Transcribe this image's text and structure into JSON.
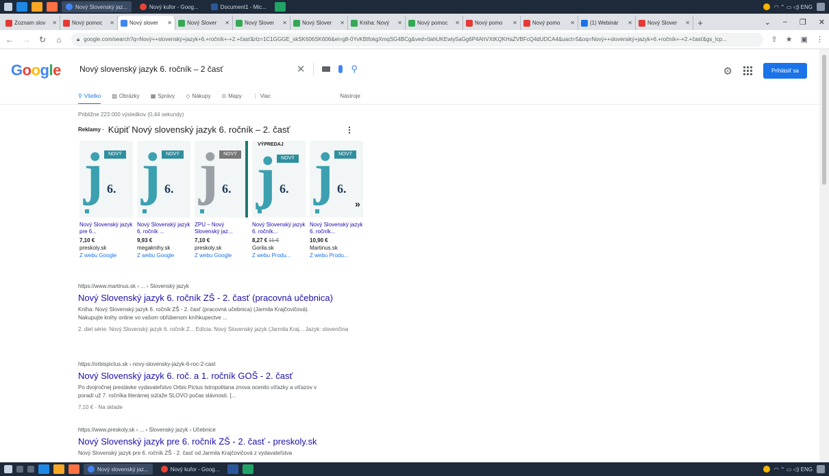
{
  "taskbar_top": {
    "apps": [
      {
        "label": "Nový Slovenský jaz...",
        "active": true
      },
      {
        "label": "Nový kufor - Goog...",
        "active": false
      },
      {
        "label": "Document1 - Mic...",
        "active": false
      }
    ]
  },
  "taskbar_bottom": {
    "apps": [
      {
        "label": "Nový slovenský jaz...",
        "active": true
      },
      {
        "label": "Nový kufor - Goog...",
        "active": false
      }
    ]
  },
  "browser_tabs": [
    {
      "title": "Zoznam slov",
      "color": "#e53935"
    },
    {
      "title": "Nový pomoc",
      "color": "#e53935"
    },
    {
      "title": "Nový slover",
      "color": "#4285f4"
    },
    {
      "title": "Nový Slover",
      "color": "#34a853"
    },
    {
      "title": "Nový Slover",
      "color": "#34a853"
    },
    {
      "title": "Nový Slover",
      "color": "#34a853"
    },
    {
      "title": "Kniha: Nový",
      "color": "#34a853"
    },
    {
      "title": "Nový pomoc",
      "color": "#34a853"
    },
    {
      "title": "Nový pomo",
      "color": "#e53935"
    },
    {
      "title": "Nový pomo",
      "color": "#e53935"
    },
    {
      "title": "(1) Webinár",
      "color": "#1a73e8"
    },
    {
      "title": "Nový Slover",
      "color": "#e53935"
    }
  ],
  "address": {
    "url": "google.com/search?q=Nový++slovenský+jazyk+6.+ročník+-+2.+časť&rlz=1C1GGGE_skSK606SK606&ei=g8-0YvKBtfokgXmqSG4BCg&ved=0ahUKEwiy5aGg6P4AhVXtKQKHaZVBFcQ4dUDCA4&uact=5&oq=Nový++slovenský+jazyk+6.+ročník+-+2.+časť&gs_lcp..."
  },
  "search": {
    "query": "Nový slovenský jazyk 6. ročník – 2 časť",
    "signin_label": "Prihlásiť sa"
  },
  "logo": [
    "G",
    "o",
    "o",
    "g",
    "l",
    "e"
  ],
  "search_tabs": [
    {
      "label": "Všetko",
      "icon": "search-icon"
    },
    {
      "label": "Obrázky",
      "icon": "image-icon"
    },
    {
      "label": "Správy",
      "icon": "news-icon"
    },
    {
      "label": "Nákupy",
      "icon": "tag-icon"
    },
    {
      "label": "Mapy",
      "icon": "location-icon"
    },
    {
      "label": "Viac",
      "icon": "more-icon"
    }
  ],
  "tools_label": "Nástroje",
  "results_count": "Približne 223 000 výsledkov (0,44 sekundy)",
  "ads": {
    "label": "Reklamy ·",
    "title": "Kúpiť Nový slovenský jazyk 6. ročník – 2. časť"
  },
  "products": [
    {
      "name": "Nový Slovenský jazyk pre 6...",
      "price": "7,10 €",
      "old_price": "",
      "shop": "preskoly.sk",
      "via": "Z webu Google"
    },
    {
      "name": "Nový Slovenský jazyk 6. ročník ...",
      "price": "9,93 €",
      "old_price": "",
      "shop": "megaknihy.sk",
      "via": "Z webu Google"
    },
    {
      "name": "ZPU – Nový Slovenský jaz...",
      "price": "7,10 €",
      "old_price": "",
      "shop": "preskoly.sk",
      "via": "Z webu Google"
    },
    {
      "name": "Nový Slovenský jazyk 6. ročník...",
      "price": "8,27 €",
      "old_price": "11 €",
      "shop": "Gorila.sk",
      "via": "Z webu Produ..."
    },
    {
      "name": "Nový Slovenský jazyk 6. ročník...",
      "price": "10,90 €",
      "old_price": "",
      "shop": "Martinus.sk",
      "via": "Z webu Produ..."
    }
  ],
  "results": [
    {
      "crumb": "https://www.martinus.sk › ... › Slovenský jazyk",
      "title": "Nový Slovenský jazyk 6. ročník ZŠ - 2. časť (pracovná učebnica)",
      "snippet": "Kniha: Nový Slovenský jazyk 6. ročník ZŠ - 2. časť (pracovná učebnica) (Jarmila Krajčovičová). Nakupujte knihy online vo vašom obľúbenom kníhkupectve ...",
      "meta": "2. diel série: Nový Slovenský jazyk 6. ročník Z...   Edícia: Nový Slovenský jazyk (Jarmila Kraj...   Jazyk: slovenčina"
    },
    {
      "crumb": "https://orbispictus.sk › novy-slovensky-jazyk-6-roc-2-cast",
      "title": "Nový Slovenský jazyk 6. roč. a 1. ročník GOŠ - 2. časť",
      "snippet": "Po dvojročnej prestávke vydavateľstvo Orbis Pictus Istropolitana znova ocenilo víťazky a víťazov v poradí už 7. ročníka literárnej súťaže SLOVO počas slávnosti. [...",
      "meta": "7,10 €  · Na sklade"
    },
    {
      "crumb": "https://www.preskoly.sk › ... › Slovenský jazyk › Učebnice",
      "title": "Nový Slovenský jazyk pre 6. ročník ZŠ - 2. časť - preskoly.sk",
      "snippet": "Nový Slovenský jazyk pre 6. ročník ZŠ - 2. časť od Jarmila Krajčovičová z vydavateľstva",
      "meta": ""
    }
  ]
}
